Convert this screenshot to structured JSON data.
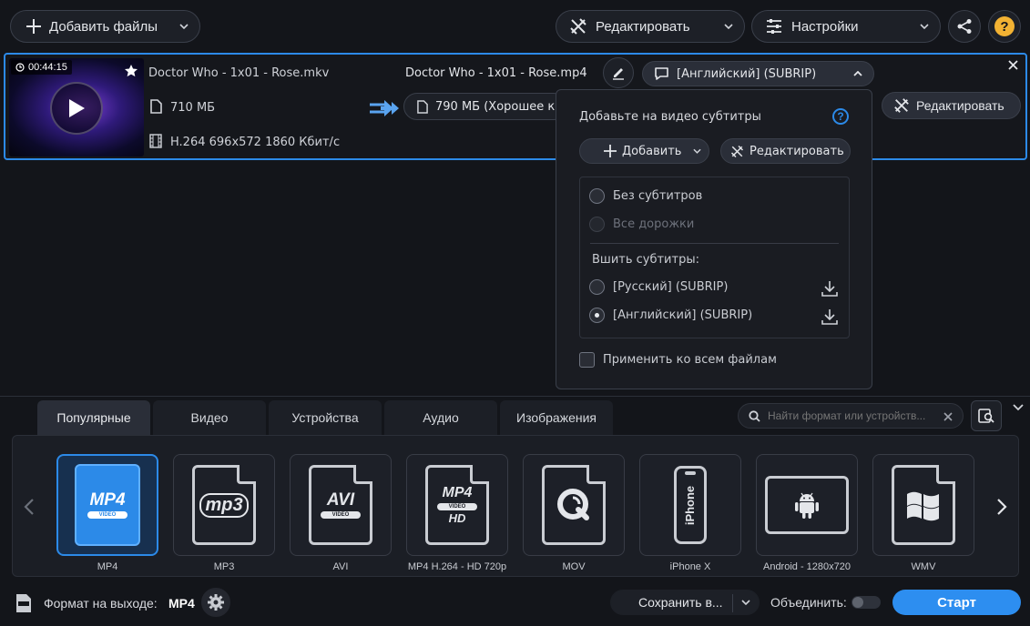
{
  "toolbar": {
    "add_files": "Добавить файлы",
    "edit": "Редактировать",
    "settings": "Настройки"
  },
  "file": {
    "duration": "00:44:15",
    "src_name": "Doctor Who - 1x01 - Rose.mkv",
    "src_size": "710 МБ",
    "src_codec": "H.264 696x572 1860 Кбит/с",
    "out_name": "Doctor Who - 1x01 - Rose.mp4",
    "out_size": "790 МБ (Хорошее к",
    "subtitle_track": "[Английский] (SUBRIP)",
    "edit_label": "Редактировать"
  },
  "subs_popup": {
    "title": "Добавьте на видео субтитры",
    "add_label": "Добавить",
    "edit_label": "Редактировать",
    "no_subs": "Без субтитров",
    "all_tracks": "Все дорожки",
    "burn_label": "Вшить субтитры:",
    "tracks": [
      {
        "label": "[Русский] (SUBRIP)",
        "selected": false
      },
      {
        "label": "[Английский] (SUBRIP)",
        "selected": true
      }
    ],
    "apply_all": "Применить ко всем файлам"
  },
  "tabs": [
    {
      "label": "Популярные",
      "active": true
    },
    {
      "label": "Видео",
      "active": false
    },
    {
      "label": "Устройства",
      "active": false
    },
    {
      "label": "Аудио",
      "active": false
    },
    {
      "label": "Изображения",
      "active": false
    }
  ],
  "search": {
    "placeholder": "Найти формат или устройств..."
  },
  "formats": [
    {
      "label": "MP4",
      "icon": "mp4-icon",
      "selected": true
    },
    {
      "label": "MP3",
      "icon": "mp3-icon",
      "selected": false
    },
    {
      "label": "AVI",
      "icon": "avi-icon",
      "selected": false
    },
    {
      "label": "MP4 H.264 - HD 720p",
      "icon": "mp4-hd-icon",
      "selected": false
    },
    {
      "label": "MOV",
      "icon": "quicktime-icon",
      "selected": false
    },
    {
      "label": "iPhone X",
      "icon": "iphone-icon",
      "selected": false
    },
    {
      "label": "Android - 1280x720",
      "icon": "android-tablet-icon",
      "selected": false
    },
    {
      "label": "WMV",
      "icon": "windows-icon",
      "selected": false
    }
  ],
  "format_icon_text": {
    "mp4": "MP4",
    "mp4_band": "VIDEO",
    "mp3": "mp3",
    "avi": "AVI",
    "avi_band": "VIDEO",
    "hd_top": "MP4",
    "hd_band": "VIDEO",
    "hd_bottom": "HD",
    "iphone": "iPhone"
  },
  "footer": {
    "output_label": "Формат на выходе:",
    "output_value": "MP4",
    "save_label": "Сохранить в...",
    "merge_label": "Объединить:",
    "start_label": "Старт"
  },
  "colors": {
    "accent": "#2c8ae8",
    "start": "#2d8ef0",
    "background": "#13151a",
    "help": "#f2b233"
  }
}
